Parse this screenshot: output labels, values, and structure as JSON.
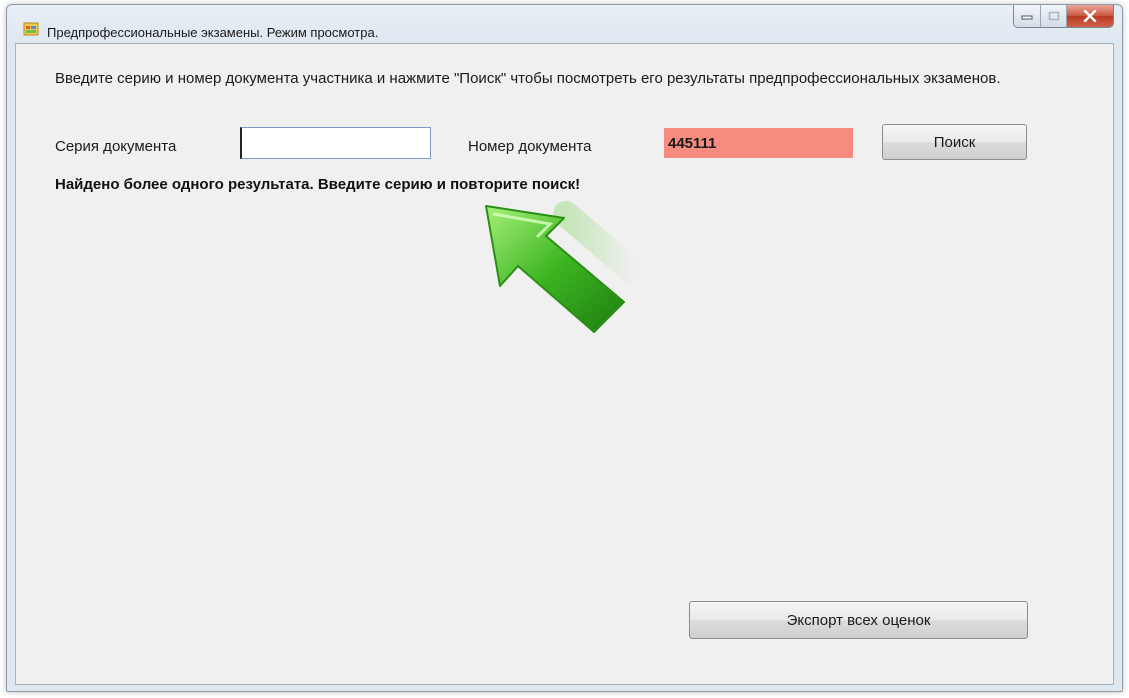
{
  "window": {
    "title": "Предпрофессиональные экзамены. Режим просмотра."
  },
  "intro_text": "Введите серию и номер документа участника и нажмите \"Поиск\" чтобы посмотреть его результаты предпрофессиональных экзаменов.",
  "series": {
    "label": "Серия документа",
    "value": ""
  },
  "number": {
    "label": "Номер документа",
    "value": "445111"
  },
  "search_button_label": "Поиск",
  "message": "Найдено более одного результата. Введите серию и повторите поиск!",
  "export_button_label": "Экспорт всех оценок",
  "icons": {
    "app": "app-icon",
    "minimize": "minimize-icon",
    "maximize": "maximize-icon",
    "close": "close-icon",
    "arrow": "green-arrow-icon"
  },
  "colors": {
    "number_field_highlight": "#f58c7f",
    "arrow_green": "#3cb521",
    "close_button": "#c8553f"
  }
}
